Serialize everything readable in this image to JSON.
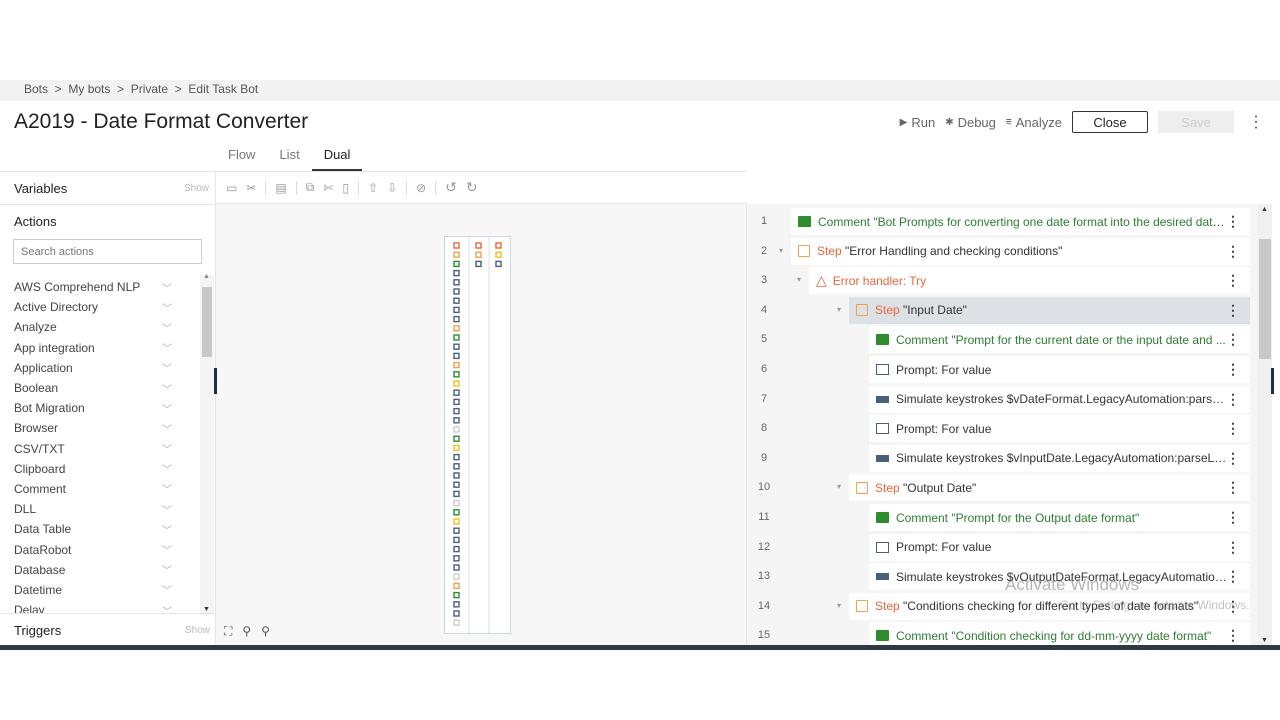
{
  "breadcrumb": [
    "Bots",
    "My bots",
    "Private",
    "Edit Task Bot"
  ],
  "title": "A2019 - Date Format Converter",
  "header_actions": {
    "run": "Run",
    "debug": "Debug",
    "analyze": "Analyze",
    "close": "Close",
    "save": "Save"
  },
  "tabs": [
    {
      "label": "Flow"
    },
    {
      "label": "List"
    },
    {
      "label": "Dual",
      "active": true
    }
  ],
  "left": {
    "variables": "Variables",
    "variables_show": "Show",
    "actions": "Actions",
    "search_placeholder": "Search actions",
    "action_items": [
      "AWS Comprehend NLP",
      "Active Directory",
      "Analyze",
      "App integration",
      "Application",
      "Boolean",
      "Bot Migration",
      "Browser",
      "CSV/TXT",
      "Clipboard",
      "Comment",
      "DLL",
      "Data Table",
      "DataRobot",
      "Database",
      "Datetime",
      "Delay"
    ],
    "triggers": "Triggers",
    "triggers_show": "Show"
  },
  "rows": [
    {
      "n": "1",
      "level": 0,
      "icon": "comment",
      "kw": "Comment",
      "text": " \"Bot Prompts for converting one date format into the desired date ...",
      "style": "green"
    },
    {
      "n": "2",
      "level": 0,
      "icon": "step",
      "kw": "Step",
      "text": " \"Error Handling and checking conditions\"",
      "twisty": true
    },
    {
      "n": "3",
      "level": 1,
      "icon": "error",
      "kw": "Error handler: Try",
      "text": "",
      "twisty": true
    },
    {
      "n": "4",
      "level": 2,
      "icon": "step",
      "kw": "Step",
      "text": " \"Input Date\"",
      "twisty": true,
      "selected": true
    },
    {
      "n": "5",
      "level": 3,
      "icon": "comment",
      "kw": "Comment",
      "text": " \"Prompt for the current date or the input date and ...",
      "style": "green"
    },
    {
      "n": "6",
      "level": 3,
      "icon": "prompt",
      "kw": "",
      "text": "Prompt: For value"
    },
    {
      "n": "7",
      "level": 3,
      "icon": "keys",
      "kw": "",
      "text": "Simulate keystrokes $vDateFormat.LegacyAutomation:parseL..."
    },
    {
      "n": "8",
      "level": 3,
      "icon": "prompt",
      "kw": "",
      "text": "Prompt: For value"
    },
    {
      "n": "9",
      "level": 3,
      "icon": "keys",
      "kw": "",
      "text": "Simulate keystrokes $vInputDate.LegacyAutomation:parseLe..."
    },
    {
      "n": "10",
      "level": 2,
      "icon": "step",
      "kw": "Step",
      "text": " \"Output Date\"",
      "twisty": true
    },
    {
      "n": "11",
      "level": 3,
      "icon": "comment",
      "kw": "Comment",
      "text": " \"Prompt for the Output date format\"",
      "style": "green"
    },
    {
      "n": "12",
      "level": 3,
      "icon": "prompt",
      "kw": "",
      "text": "Prompt: For value"
    },
    {
      "n": "13",
      "level": 3,
      "icon": "keys",
      "kw": "",
      "text": "Simulate keystrokes $vOutputDateFormat.LegacyAutomation..."
    },
    {
      "n": "14",
      "level": 2,
      "icon": "step",
      "kw": "Step",
      "text": " \"Conditions checking for different types of date formats\"",
      "twisty": true
    },
    {
      "n": "15",
      "level": 3,
      "icon": "comment",
      "kw": "Comment",
      "text": " \"Condition checking for dd-mm-yyyy date format\"",
      "style": "green"
    }
  ],
  "watermark": {
    "line1": "Activate Windows",
    "line2": "Go to Settings to activate Windows."
  },
  "colors": {
    "comment": "#2e7d32",
    "step": "#e8663d",
    "accent": "#2d3a44"
  }
}
